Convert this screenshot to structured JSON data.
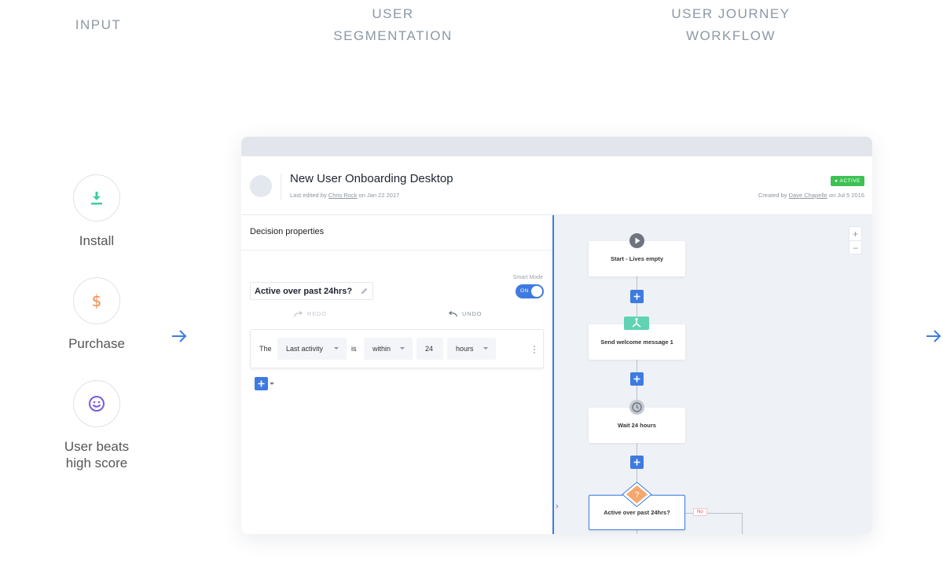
{
  "columns": {
    "input": "INPUT",
    "segmentation_line1": "USER",
    "segmentation_line2": "SEGMENTATION",
    "journey_line1": "USER JOURNEY",
    "journey_line2": "WORKFLOW"
  },
  "inputs": [
    {
      "label": "Install",
      "icon": "download-icon",
      "color": "#3ecf9b"
    },
    {
      "label": "Purchase",
      "icon": "dollar-icon",
      "color": "#f5884a"
    },
    {
      "label_line1": "User beats",
      "label_line2": "high score",
      "icon": "smiley-icon",
      "color": "#7a5ae0"
    }
  ],
  "app": {
    "title": "New User Onboarding Desktop",
    "edited_prefix": "Last edited by",
    "edited_by": "Chris Rock",
    "edited_on": "on Jan 22 2017",
    "status": "ACTIVE",
    "created_prefix": "Created by",
    "created_by": "Dave Chapelle",
    "created_on": "on Jul 5 2016"
  },
  "decision_panel": {
    "title": "Decision properties",
    "decision_name": "Active over past 24hrs?",
    "smart_mode_label": "Smart Mode",
    "smart_mode_state": "ON",
    "redo_label": "REDO",
    "undo_label": "UNDO",
    "condition": {
      "prefix": "The",
      "field": "Last activity",
      "operator": "is",
      "comparator": "within",
      "amount": "24",
      "unit": "hours"
    }
  },
  "workflow": {
    "nodes": [
      {
        "label": "Start - Lives empty",
        "icon": "play-icon"
      },
      {
        "label": "Send welcome message 1",
        "icon": "split-icon"
      },
      {
        "label": "Wait 24 hours",
        "icon": "clock-icon"
      },
      {
        "label": "Active over past 24hrs?",
        "icon": "question-icon"
      }
    ],
    "branch_label": "No"
  },
  "colors": {
    "accent": "#3e7be0",
    "active_badge": "#3ec154",
    "decision_orange": "#f5a86e",
    "split_teal": "#5fd3b3"
  }
}
